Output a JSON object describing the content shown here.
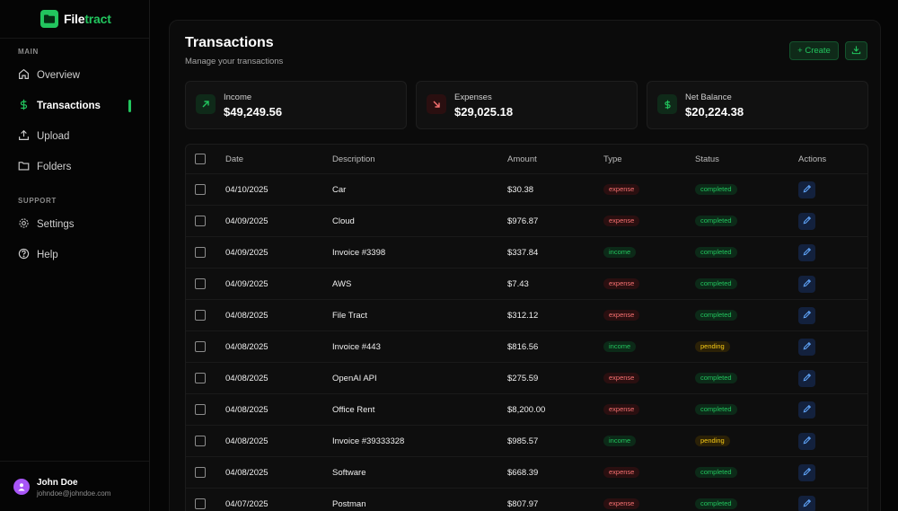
{
  "brand": {
    "part1": "File",
    "part2": "tract"
  },
  "sidebar": {
    "main_label": "MAIN",
    "support_label": "SUPPORT",
    "main_items": [
      {
        "label": "Overview",
        "icon": "home-icon"
      },
      {
        "label": "Transactions",
        "icon": "dollar-icon",
        "active": true
      },
      {
        "label": "Upload",
        "icon": "upload-icon"
      },
      {
        "label": "Folders",
        "icon": "folder-icon"
      }
    ],
    "support_items": [
      {
        "label": "Settings",
        "icon": "gear-icon"
      },
      {
        "label": "Help",
        "icon": "help-icon"
      }
    ]
  },
  "user": {
    "name": "John Doe",
    "email": "johndoe@johndoe.com"
  },
  "header": {
    "title": "Transactions",
    "subtitle": "Manage your transactions",
    "create_label": "+ Create"
  },
  "cards": [
    {
      "label": "Income",
      "value": "$49,249.56",
      "icon": "arrow-up-right-icon"
    },
    {
      "label": "Expenses",
      "value": "$29,025.18",
      "icon": "arrow-down-right-icon"
    },
    {
      "label": "Net Balance",
      "value": "$20,224.38",
      "icon": "dollar-icon"
    }
  ],
  "table": {
    "columns": [
      "Date",
      "Description",
      "Amount",
      "Type",
      "Status",
      "Actions"
    ],
    "rows": [
      {
        "date": "04/10/2025",
        "description": "Car",
        "amount": "$30.38",
        "type": "expense",
        "status": "completed"
      },
      {
        "date": "04/09/2025",
        "description": "Cloud",
        "amount": "$976.87",
        "type": "expense",
        "status": "completed"
      },
      {
        "date": "04/09/2025",
        "description": "Invoice #3398",
        "amount": "$337.84",
        "type": "income",
        "status": "completed"
      },
      {
        "date": "04/09/2025",
        "description": "AWS",
        "amount": "$7.43",
        "type": "expense",
        "status": "completed"
      },
      {
        "date": "04/08/2025",
        "description": "File Tract",
        "amount": "$312.12",
        "type": "expense",
        "status": "completed"
      },
      {
        "date": "04/08/2025",
        "description": "Invoice #443",
        "amount": "$816.56",
        "type": "income",
        "status": "pending"
      },
      {
        "date": "04/08/2025",
        "description": "OpenAI API",
        "amount": "$275.59",
        "type": "expense",
        "status": "completed"
      },
      {
        "date": "04/08/2025",
        "description": "Office Rent",
        "amount": "$8,200.00",
        "type": "expense",
        "status": "completed"
      },
      {
        "date": "04/08/2025",
        "description": "Invoice #39333328",
        "amount": "$985.57",
        "type": "income",
        "status": "pending"
      },
      {
        "date": "04/08/2025",
        "description": "Software",
        "amount": "$668.39",
        "type": "expense",
        "status": "completed"
      },
      {
        "date": "04/07/2025",
        "description": "Postman",
        "amount": "$807.97",
        "type": "expense",
        "status": "completed"
      }
    ]
  },
  "colors": {
    "accent": "#22c55e",
    "expense": "#f87171",
    "pending": "#facc15",
    "background": "#050505"
  }
}
